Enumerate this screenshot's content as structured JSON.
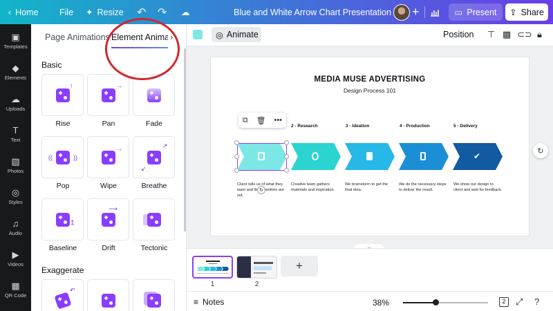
{
  "topbar": {
    "home": "Home",
    "file": "File",
    "resize": "Resize",
    "title": "Blue and White Arrow Chart Presentation",
    "present": "Present",
    "share": "Share"
  },
  "rail": [
    {
      "label": "Templates",
      "icon": "▣"
    },
    {
      "label": "Elements",
      "icon": "◆"
    },
    {
      "label": "Uploads",
      "icon": "☁"
    },
    {
      "label": "Text",
      "icon": "T"
    },
    {
      "label": "Photos",
      "icon": "▨"
    },
    {
      "label": "Styles",
      "icon": "◎"
    },
    {
      "label": "Audio",
      "icon": "♫"
    },
    {
      "label": "Videos",
      "icon": "▶"
    },
    {
      "label": "QR Code",
      "icon": "▦"
    }
  ],
  "panel": {
    "tabs": [
      "Page Animations",
      "Element Anima"
    ],
    "basic_heading": "Basic",
    "exaggerate_heading": "Exaggerate",
    "basic": [
      "Rise",
      "Pan",
      "Fade",
      "Pop",
      "Wipe",
      "Breathe",
      "Baseline",
      "Drift",
      "Tectonic"
    ]
  },
  "toolbar": {
    "animate": "Animate",
    "position": "Position"
  },
  "slide": {
    "title": "MEDIA MUSE ADVERTISING",
    "subtitle": "Design Process 101",
    "steps": [
      {
        "heading": "",
        "desc": "Client tells us of what they want and the Timelines are set.",
        "color": "#7ce8e6"
      },
      {
        "heading": "2 - Research",
        "desc": "Creative team gathers materials and inspiration.",
        "color": "#2bd4d0"
      },
      {
        "heading": "3 - Ideation",
        "desc": "We brainstorm to get the final idea.",
        "color": "#26b8e6"
      },
      {
        "heading": "4 - Production",
        "desc": "We do the necessary steps to deliver the result.",
        "color": "#1b8fd6"
      },
      {
        "heading": "5 - Delivery",
        "desc": "We show our design to client and wait for feedback.",
        "color": "#125aa1"
      }
    ]
  },
  "pages": {
    "numbers": [
      "1",
      "2"
    ]
  },
  "bottombar": {
    "notes": "Notes",
    "zoom": "38%",
    "zoom_fraction": 0.38,
    "page_count": "2"
  }
}
